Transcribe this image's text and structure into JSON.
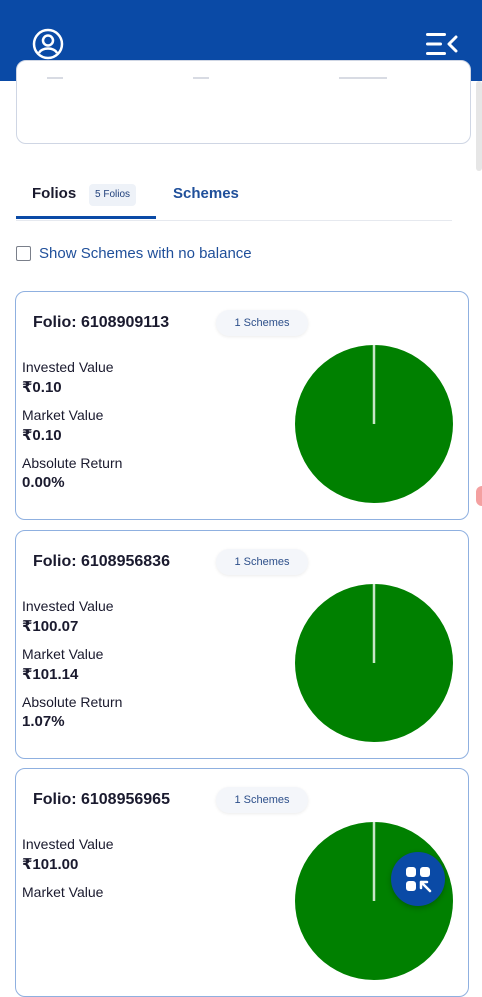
{
  "header": {
    "profile_icon": "user-circle-icon",
    "menu_icon": "menu-collapse-icon"
  },
  "tabs": {
    "folios_label": "Folios",
    "folios_badge": "5 Folios",
    "schemes_label": "Schemes"
  },
  "filter": {
    "show_no_balance_label": "Show Schemes with no balance",
    "checked": false
  },
  "colors": {
    "primary": "#0a4aa6",
    "pie_green": "#008000",
    "card_border": "#8fb0e0"
  },
  "labels": {
    "invested": "Invested Value",
    "market": "Market Value",
    "absolute_return": "Absolute Return"
  },
  "folios": [
    {
      "title": "Folio: 6108909113",
      "schemes": "1 Schemes",
      "invested": "₹0.10",
      "market": "₹0.10",
      "return": "0.00%"
    },
    {
      "title": "Folio: 6108956836",
      "schemes": "1 Schemes",
      "invested": "₹100.07",
      "market": "₹101.14",
      "return": "1.07%"
    },
    {
      "title": "Folio: 6108956965",
      "schemes": "1 Schemes",
      "invested": "₹101.00",
      "market": "",
      "return": ""
    }
  ],
  "fab_icon": "grid-shrink-icon"
}
